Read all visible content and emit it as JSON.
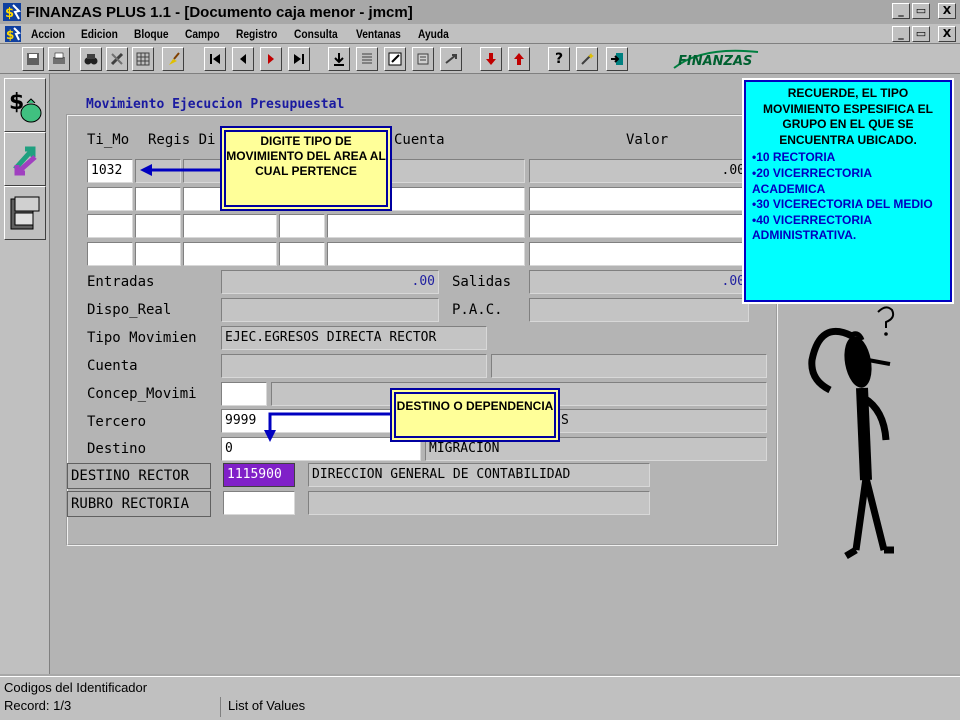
{
  "window": {
    "title": "FINANZAS PLUS 1.1 - [Documento caja menor - jmcm]",
    "controls": [
      "_",
      "▭",
      "X"
    ]
  },
  "menu": [
    "Accion",
    "Edicion",
    "Bloque",
    "Campo",
    "Registro",
    "Consulta",
    "Ventanas",
    "Ayuda"
  ],
  "logo_text": "FINANZAS",
  "form": {
    "title": "Movimiento Ejecucion Presupuestal",
    "grid_headers": {
      "ti_mo": "Ti_Mo",
      "regis": "Regis Di",
      "cuenta": "Cuenta",
      "valor": "Valor"
    },
    "grid_rows": [
      {
        "ti_mo": "1032",
        "valor": ".00"
      },
      {
        "ti_mo": "",
        "valor": ""
      },
      {
        "ti_mo": "",
        "valor": ""
      },
      {
        "ti_mo": "",
        "valor": ""
      }
    ],
    "entradas_label": "Entradas",
    "entradas_value": ".00",
    "salidas_label": "Salidas",
    "salidas_value": ".00",
    "dispo_label": "Dispo_Real",
    "pac_label": "P.A.C.",
    "tipo_label": "Tipo Movimien",
    "tipo_value": "EJEC.EGRESOS DIRECTA RECTOR",
    "cuenta_label": "Cuenta",
    "concep_label": "Concep_Movimi",
    "tercero_label": "Tercero",
    "tercero_value": "9999",
    "tercero_desc": "S",
    "destino_label": "Destino",
    "destino_value": "0",
    "destino_desc": "MIGRACION",
    "destino_rector_label": "DESTINO RECTOR",
    "destino_rector_value": "1115900",
    "destino_rector_desc": "DIRECCION GENERAL DE CONTABILIDAD",
    "rubro_label": "RUBRO RECTORIA"
  },
  "callouts": {
    "tipo": "DIGITE TIPO DE MOVIMIENTO DEL AREA AL CUAL PERTENCE",
    "destino": "DESTINO O DEPENDENCIA"
  },
  "note": {
    "header": "RECUERDE, EL TIPO MOVIMIENTO ESPESIFICA EL GRUPO EN EL QUE SE ENCUENTRA UBICADO.",
    "items": [
      "10 RECTORIA",
      "20 VICERRECTORIA ACADEMICA",
      "30 VICERECTORIA DEL MEDIO",
      "40 VICERRECTORIA ADMINISTRATIVA."
    ]
  },
  "status": {
    "line1": "Codigos del Identificador",
    "line2": "Record: 1/3",
    "line3": "List of Values"
  },
  "colors": {
    "note_bg": "#00ffff",
    "callout_bg": "#ffff99",
    "highlight": "#8020c8",
    "title_blue": "#1a1aa0"
  }
}
